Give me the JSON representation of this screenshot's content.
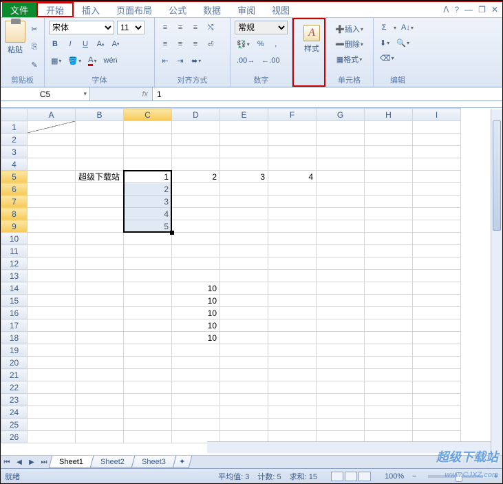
{
  "tabs": {
    "file": "文件",
    "home": "开始",
    "insert": "插入",
    "layout": "页面布局",
    "formula": "公式",
    "data": "数据",
    "review": "审阅",
    "view": "视图"
  },
  "ribbon": {
    "clipboard": {
      "label": "剪贴板",
      "paste": "粘贴"
    },
    "font": {
      "label": "字体",
      "name": "宋体",
      "size": "11",
      "bold": "B",
      "italic": "I",
      "underline": "U"
    },
    "align": {
      "label": "对齐方式"
    },
    "number": {
      "label": "数字",
      "format": "常规",
      "percent": "%"
    },
    "style": {
      "label": "样式",
      "btn": "样式",
      "glyph": "A"
    },
    "cells": {
      "label": "单元格",
      "insert": "插入",
      "delete": "删除",
      "format": "格式"
    },
    "editing": {
      "label": "编辑",
      "sigma": "Σ"
    }
  },
  "namebox": "C5",
  "fx": "fx",
  "formula": "1",
  "columns": [
    "A",
    "B",
    "C",
    "D",
    "E",
    "F",
    "G",
    "H",
    "I"
  ],
  "rows": [
    "1",
    "2",
    "3",
    "4",
    "5",
    "6",
    "7",
    "8",
    "9",
    "10",
    "11",
    "12",
    "13",
    "14",
    "15",
    "16",
    "17",
    "18",
    "19",
    "20",
    "21",
    "22",
    "23",
    "24",
    "25",
    "26"
  ],
  "cells": {
    "B5": "超级下载站",
    "C5": "1",
    "C6": "2",
    "C7": "3",
    "C8": "4",
    "C9": "5",
    "D5": "2",
    "E5": "3",
    "F5": "4",
    "D14": "10",
    "D15": "10",
    "D16": "10",
    "D17": "10",
    "D18": "10"
  },
  "sheets": [
    "Sheet1",
    "Sheet2",
    "Sheet3"
  ],
  "status": {
    "ready": "就绪",
    "avg": "平均值: 3",
    "count": "计数: 5",
    "sum": "求和: 15",
    "zoom": "100%",
    "minus": "−",
    "plus": "+"
  },
  "watermark": "超级下载站",
  "watermark2": "www.CJXZ.com",
  "chart_data": null
}
